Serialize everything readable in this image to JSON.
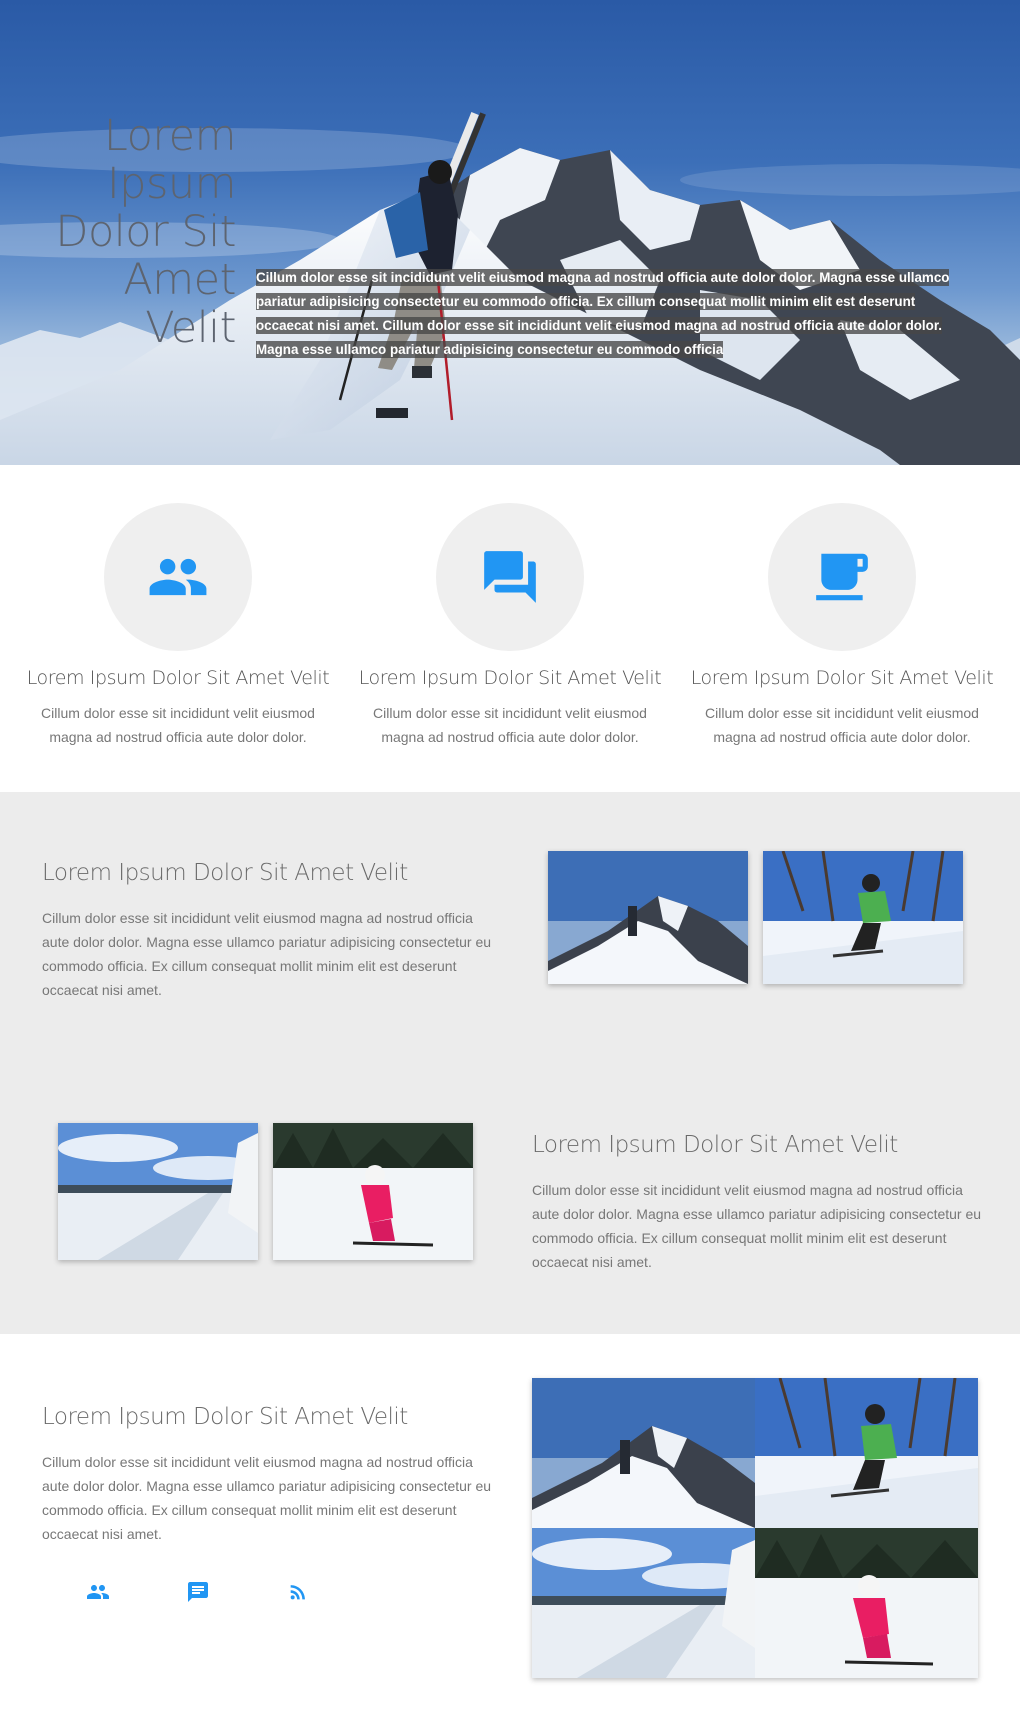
{
  "hero": {
    "title_lines": [
      "Lorem",
      "Ipsum",
      "Dolor Sit",
      "Amet",
      "Velit"
    ],
    "text": "Cillum dolor esse sit incididunt velit eiusmod magna ad nostrud officia aute dolor dolor. Magna esse ullamco pariatur adipisicing consectetur eu commodo officia. Ex cillum consequat mollit minim elit est deserunt occaecat nisi amet. Cillum dolor esse sit incididunt velit eiusmod magna ad nostrud officia aute dolor dolor. Magna esse ullamco pariatur adipisicing consectetur eu commodo officia"
  },
  "features": [
    {
      "icon": "people-icon",
      "title": "Lorem Ipsum Dolor Sit Amet Velit",
      "text": "Cillum dolor esse sit incididunt velit eiusmod magna ad nostrud officia aute dolor dolor."
    },
    {
      "icon": "forum-icon",
      "title": "Lorem Ipsum Dolor Sit Amet Velit",
      "text": "Cillum dolor esse sit incididunt velit eiusmod magna ad nostrud officia aute dolor dolor."
    },
    {
      "icon": "coffee-cup-icon",
      "title": "Lorem Ipsum Dolor Sit Amet Velit",
      "text": "Cillum dolor esse sit incididunt velit eiusmod magna ad nostrud officia aute dolor dolor."
    }
  ],
  "block1": {
    "title": "Lorem Ipsum Dolor Sit Amet Velit",
    "text": "Cillum dolor esse sit incididunt velit eiusmod magna ad nostrud officia aute dolor dolor. Magna esse ullamco pariatur adipisicing consectetur eu commodo officia. Ex cillum consequat mollit minim elit est deserunt occaecat nisi amet."
  },
  "block2": {
    "title": "Lorem Ipsum Dolor Sit Amet Velit",
    "text": "Cillum dolor esse sit incididunt velit eiusmod magna ad nostrud officia aute dolor dolor. Magna esse ullamco pariatur adipisicing consectetur eu commodo officia. Ex cillum consequat mollit minim elit est deserunt occaecat nisi amet."
  },
  "block3": {
    "title": "Lorem Ipsum Dolor Sit Amet Velit",
    "text": "Cillum dolor esse sit incididunt velit eiusmod magna ad nostrud officia aute dolor dolor. Magna esse ullamco pariatur adipisicing consectetur eu commodo officia. Ex cillum consequat mollit minim elit est deserunt occaecat nisi amet.",
    "social_icons": [
      "people-icon",
      "chat-icon",
      "rss-icon"
    ]
  },
  "colors": {
    "accent": "#2196f3",
    "band": "#ececec",
    "circle": "#efefef"
  }
}
